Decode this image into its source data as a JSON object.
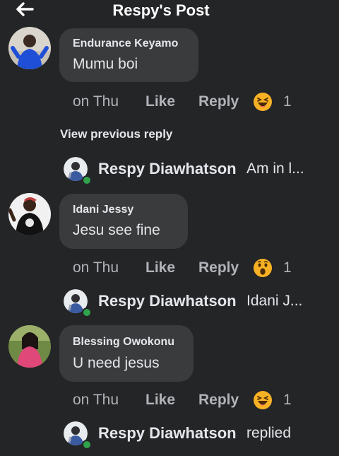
{
  "header": {
    "title": "Respy's Post",
    "back_icon": "arrow-left-icon"
  },
  "comments": [
    {
      "author": "Endurance Keyamo",
      "text": "Mumu boi",
      "time": "on Thu",
      "like_label": "Like",
      "reply_label": "Reply",
      "reaction": "laughing-emoji",
      "reaction_count": "1"
    },
    {
      "author": "Idani Jessy",
      "text": "Jesu see fine",
      "time": "on Thu",
      "like_label": "Like",
      "reply_label": "Reply",
      "reaction": "wow-emoji",
      "reaction_count": "1"
    },
    {
      "author": "Blessing Owokonu",
      "text": "U need jesus",
      "time": "on Thu",
      "like_label": "Like",
      "reply_label": "Reply",
      "reaction": "laughing-emoji",
      "reaction_count": "1"
    }
  ],
  "view_previous_reply": "View previous reply",
  "replies": [
    {
      "name": "Respy Diawhatson",
      "text": "Am in l..."
    },
    {
      "name": "Respy Diawhatson",
      "text": "Idani J..."
    },
    {
      "name": "Respy Diawhatson",
      "text": "replied"
    }
  ],
  "colors": {
    "background": "#242527",
    "bubble": "#3a3b3c",
    "meta_text": "#b0b3b8",
    "online": "#31a24c",
    "emoji": "#f7b125"
  }
}
